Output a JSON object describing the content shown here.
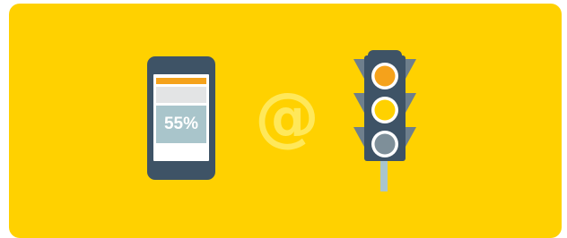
{
  "phone": {
    "percentage_label": "55%"
  },
  "separator": {
    "symbol": "@"
  },
  "traffic_light": {
    "lights": [
      "orange",
      "yellow",
      "grey"
    ]
  },
  "colors": {
    "background": "#FFD100",
    "phone_body": "#3E5366",
    "accent_orange": "#F5A21B",
    "accent_yellow": "#FFD100",
    "light_off": "#7E8F99",
    "pct_block": "#A9C5CB"
  },
  "icons": [
    "smartphone-icon",
    "at-sign-icon",
    "traffic-light-icon"
  ]
}
